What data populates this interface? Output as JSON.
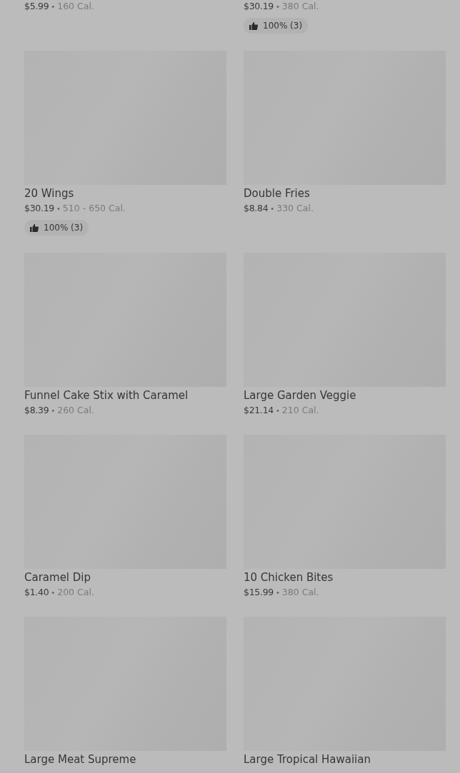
{
  "items": [
    {
      "kind": "cut_top",
      "price": "$5.99",
      "dot": "•",
      "calories": "160 Cal."
    },
    {
      "kind": "cut_top",
      "price": "$30.19",
      "dot": "•",
      "calories": "380 Cal.",
      "rating": "100% (3)"
    },
    {
      "kind": "card",
      "title": "20 Wings",
      "price": "$30.19",
      "dot": "•",
      "calories": "510 - 650 Cal.",
      "rating": "100% (3)"
    },
    {
      "kind": "card",
      "title": "Double Fries",
      "price": "$8.84",
      "dot": "•",
      "calories": "330 Cal."
    },
    {
      "kind": "card",
      "title": "Funnel Cake Stix with Caramel",
      "price": "$8.39",
      "dot": "•",
      "calories": "260 Cal."
    },
    {
      "kind": "card",
      "title": "Large Garden Veggie",
      "price": "$21.14",
      "dot": "•",
      "calories": "210 Cal."
    },
    {
      "kind": "card",
      "title": "Caramel Dip",
      "price": "$1.40",
      "dot": "•",
      "calories": "200 Cal."
    },
    {
      "kind": "card",
      "title": "10 Chicken Bites",
      "price": "$15.99",
      "dot": "•",
      "calories": "380 Cal."
    },
    {
      "kind": "card",
      "title": "Large Meat Supreme"
    },
    {
      "kind": "card",
      "title": "Large Tropical Hawaiian"
    }
  ]
}
